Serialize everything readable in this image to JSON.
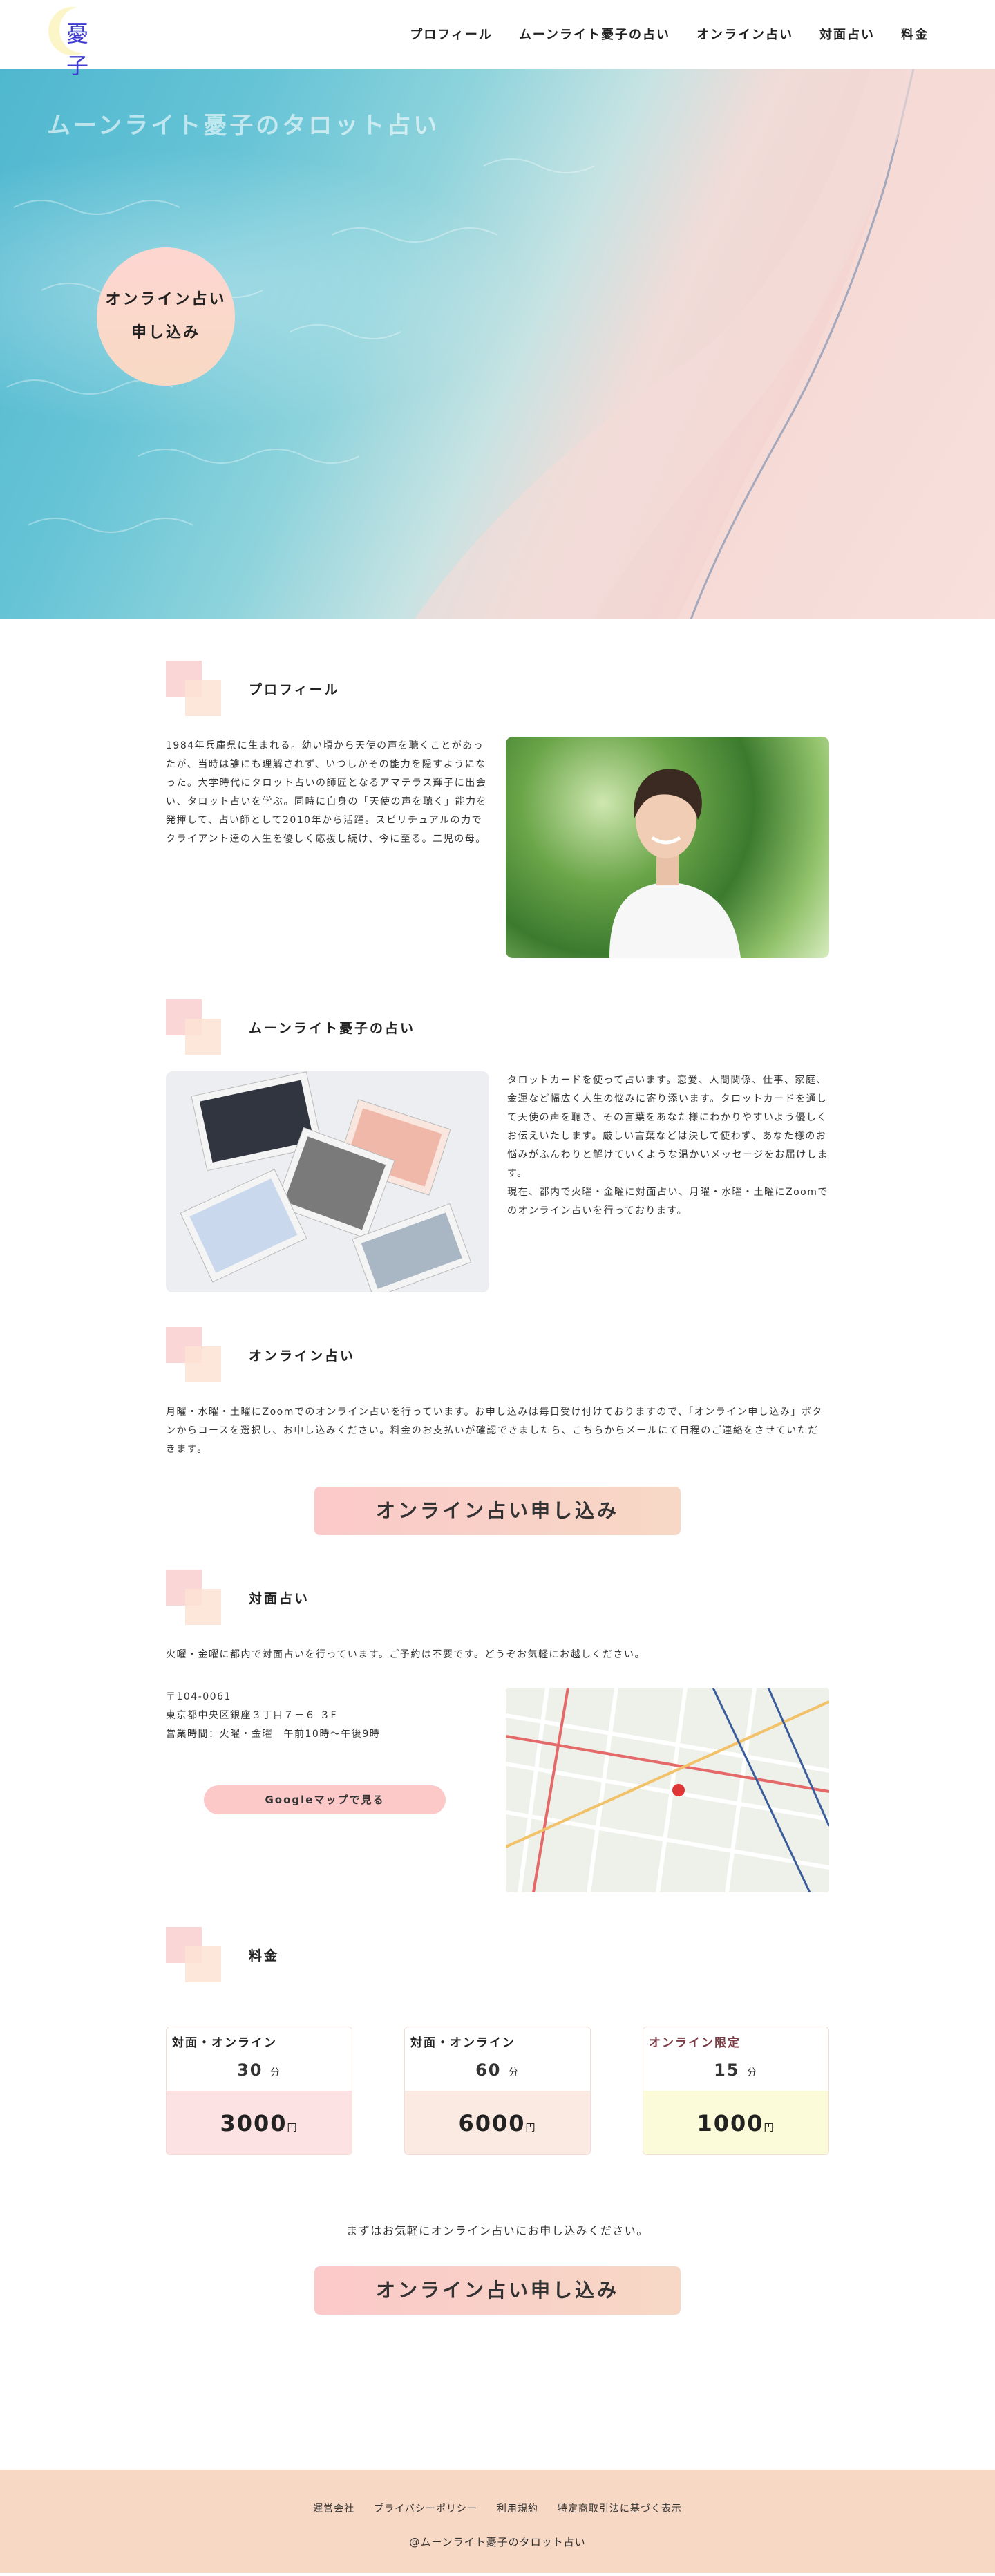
{
  "header": {
    "logo_text": "憂子",
    "nav": [
      "プロフィール",
      "ムーンライト憂子の占い",
      "オンライン占い",
      "対面占い",
      "料金"
    ]
  },
  "hero": {
    "title": "ムーンライト憂子のタロット占い",
    "cta_line1": "オンライン占い",
    "cta_line2": "申し込み"
  },
  "profile": {
    "title": "プロフィール",
    "text": "1984年兵庫県に生まれる。幼い頃から天使の声を聴くことがあったが、当時は誰にも理解されず、いつしかその能力を隠すようになった。大学時代にタロット占いの師匠となるアマテラス輝子に出会い、タロット占いを学ぶ。同時に自身の「天使の声を聴く」能力を発揮して、占い師として2010年から活躍。スピリチュアルの力でクライアント達の人生を優しく応援し続け、今に至る。二児の母。"
  },
  "reading": {
    "title": "ムーンライト憂子の占い",
    "text": "タロットカードを使って占います。恋愛、人間関係、仕事、家庭、金運など幅広く人生の悩みに寄り添います。タロットカードを通して天使の声を聴き、その言葉をあなた様にわかりやすいよう優しくお伝えいたします。厳しい言葉などは決して使わず、あなた様のお悩みがふんわりと解けていくような温かいメッセージをお届けします。",
    "text2": "現在、都内で火曜・金曜に対面占い、月曜・水曜・土曜にZoomでのオンライン占いを行っております。"
  },
  "online": {
    "title": "オンライン占い",
    "text": "月曜・水曜・土曜にZoomでのオンライン占いを行っています。お申し込みは毎日受け付けておりますので、「オンライン申し込み」ボタンからコースを選択し、お申し込みください。料金のお支払いが確認できましたら、こちらからメールにて日程のご連絡をさせていただきます。",
    "button": "オンライン占い申し込み"
  },
  "inperson": {
    "title": "対面占い",
    "text": "火曜・金曜に都内で対面占いを行っています。ご予約は不要です。どうぞお気軽にお越しください。",
    "postal": "〒104-0061",
    "address": "東京都中央区銀座３丁目７－６ ３F",
    "hours": "営業時間：火曜・金曜　午前10時〜午後9時",
    "map_button": "Googleマップで見る"
  },
  "pricing": {
    "title": "料金",
    "plans": [
      {
        "label": "対面・オンライン",
        "minutes": "30",
        "min_unit": "分",
        "price": "3000",
        "yen": "円",
        "color": "#fce2e2",
        "label_color": "#222222"
      },
      {
        "label": "対面・オンライン",
        "minutes": "60",
        "min_unit": "分",
        "price": "6000",
        "yen": "円",
        "color": "#fbeae2",
        "label_color": "#222222"
      },
      {
        "label": "オンライン限定",
        "minutes": "15",
        "min_unit": "分",
        "price": "1000",
        "yen": "円",
        "color": "#fbfbd9",
        "label_color": "#7a3b45"
      }
    ],
    "note": "まずはお気軽にオンライン占いにお申し込みください。",
    "button": "オンライン占い申し込み"
  },
  "footer": {
    "links": [
      "運営会社",
      "プライバシーポリシー",
      "利用規約",
      "特定商取引法に基づく表示"
    ],
    "copyright": "@ムーンライト憂子のタロット占い"
  }
}
